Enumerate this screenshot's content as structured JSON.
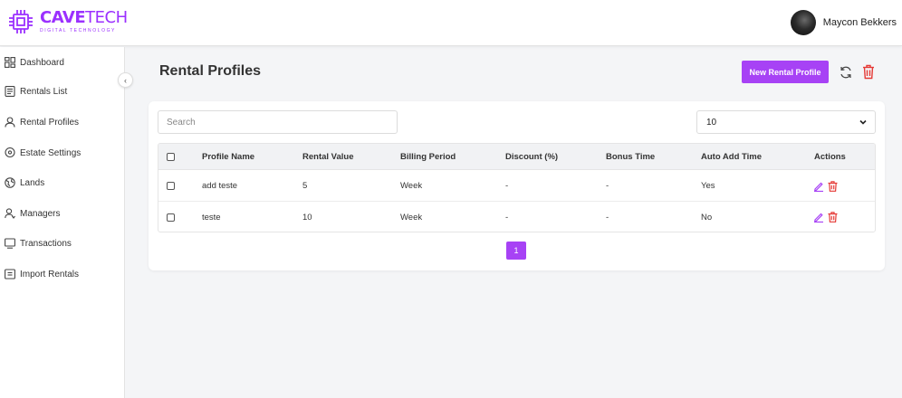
{
  "brand": {
    "name_bold": "CAVE",
    "name_light": "TECH",
    "tagline": "DIGITAL TECHNOLOGY",
    "color": "#9b30ff"
  },
  "user": {
    "name": "Maycon Bekkers"
  },
  "sidebar": {
    "items": [
      {
        "label": "Dashboard",
        "icon": "dashboard-icon"
      },
      {
        "label": "Rentals List",
        "icon": "list-icon"
      },
      {
        "label": "Rental Profiles",
        "icon": "user-icon"
      },
      {
        "label": "Estate Settings",
        "icon": "location-icon"
      },
      {
        "label": "Lands",
        "icon": "globe-icon"
      },
      {
        "label": "Managers",
        "icon": "users-icon"
      },
      {
        "label": "Transactions",
        "icon": "monitor-icon"
      },
      {
        "label": "Import Rentals",
        "icon": "import-icon"
      }
    ],
    "collapse_glyph": "‹"
  },
  "main": {
    "title": "Rental Profiles",
    "new_button_label": "New Rental Profile",
    "accent_color": "#a742f5",
    "delete_color": "#e53935"
  },
  "search": {
    "placeholder": "Search"
  },
  "page_size": {
    "selected": "10"
  },
  "table": {
    "headers": [
      "Profile Name",
      "Rental Value",
      "Billing Period",
      "Discount (%)",
      "Bonus Time",
      "Auto Add Time",
      "Actions"
    ],
    "rows": [
      {
        "profile_name": "add teste",
        "rental_value": "5",
        "billing_period": "Week",
        "discount": "-",
        "bonus_time": "-",
        "auto_add_time": "Yes"
      },
      {
        "profile_name": "teste",
        "rental_value": "10",
        "billing_period": "Week",
        "discount": "-",
        "bonus_time": "-",
        "auto_add_time": "No"
      }
    ]
  },
  "pagination": {
    "current": "1"
  }
}
